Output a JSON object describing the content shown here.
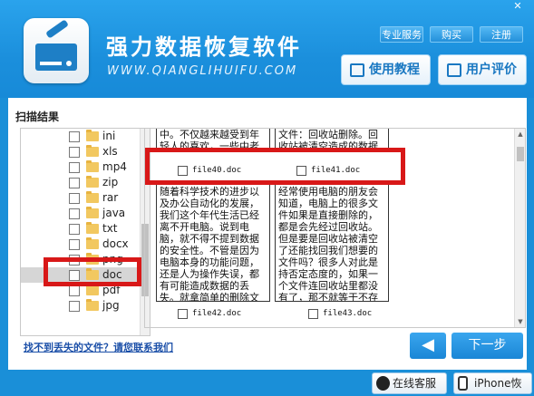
{
  "header": {
    "title": "强力数据恢复软件",
    "subtitle": "WWW.QIANGLIHUIFU.COM",
    "top_buttons": [
      "专业服务",
      "购买",
      "注册"
    ],
    "close_label": "✕",
    "tutorial_label": "使用教程",
    "rating_label": "用户评价"
  },
  "panel": {
    "scan_result_label": "扫描结果",
    "file_types": [
      {
        "name": "ini"
      },
      {
        "name": "xls"
      },
      {
        "name": "mp4"
      },
      {
        "name": "zip"
      },
      {
        "name": "rar"
      },
      {
        "name": "java"
      },
      {
        "name": "txt"
      },
      {
        "name": "docx"
      },
      {
        "name": "png"
      },
      {
        "name": "doc",
        "selected": true
      },
      {
        "name": "pdf"
      },
      {
        "name": "jpg"
      }
    ],
    "files": [
      {
        "name": "file40.doc",
        "text": "中。不仅越来越受到年轻人的喜欢，一些中老年人也开始了，做好了"
      },
      {
        "name": "file41.doc",
        "text": "文件：回收站删除。回收站被清空造成的数据丢失："
      },
      {
        "name": "file42.doc",
        "text": "随着科学技术的进步以及办公自动化的发展，我们这个年代生活已经离不开电脑。说到电脑，就不得不提到数据的安全性。不管是因为电脑本身的功能问题，还是人为操作失误，都有可能造成数据的丢失。就拿简单的删除文件来"
      },
      {
        "name": "file43.doc",
        "text": "经常使用电脑的朋友会知道，电脑上的很多文件如果是直接删除的，都是会先经过回收站。但是要是回收站被清空了还能找回我们想要的文件吗？很多人对此是持否定态度的，如果一个文件连回收站里都没有了，那不就等于不存在了吗？怎么还可"
      }
    ],
    "help_link": "找不到丢失的文件？请您联系我们",
    "back_label": "◀",
    "next_label": "下一步"
  },
  "footer": {
    "qq_label": "在线客服",
    "iphone_label": "iPhone恢复"
  },
  "colors": {
    "accent": "#1a8fd8",
    "highlight": "#d81818"
  }
}
